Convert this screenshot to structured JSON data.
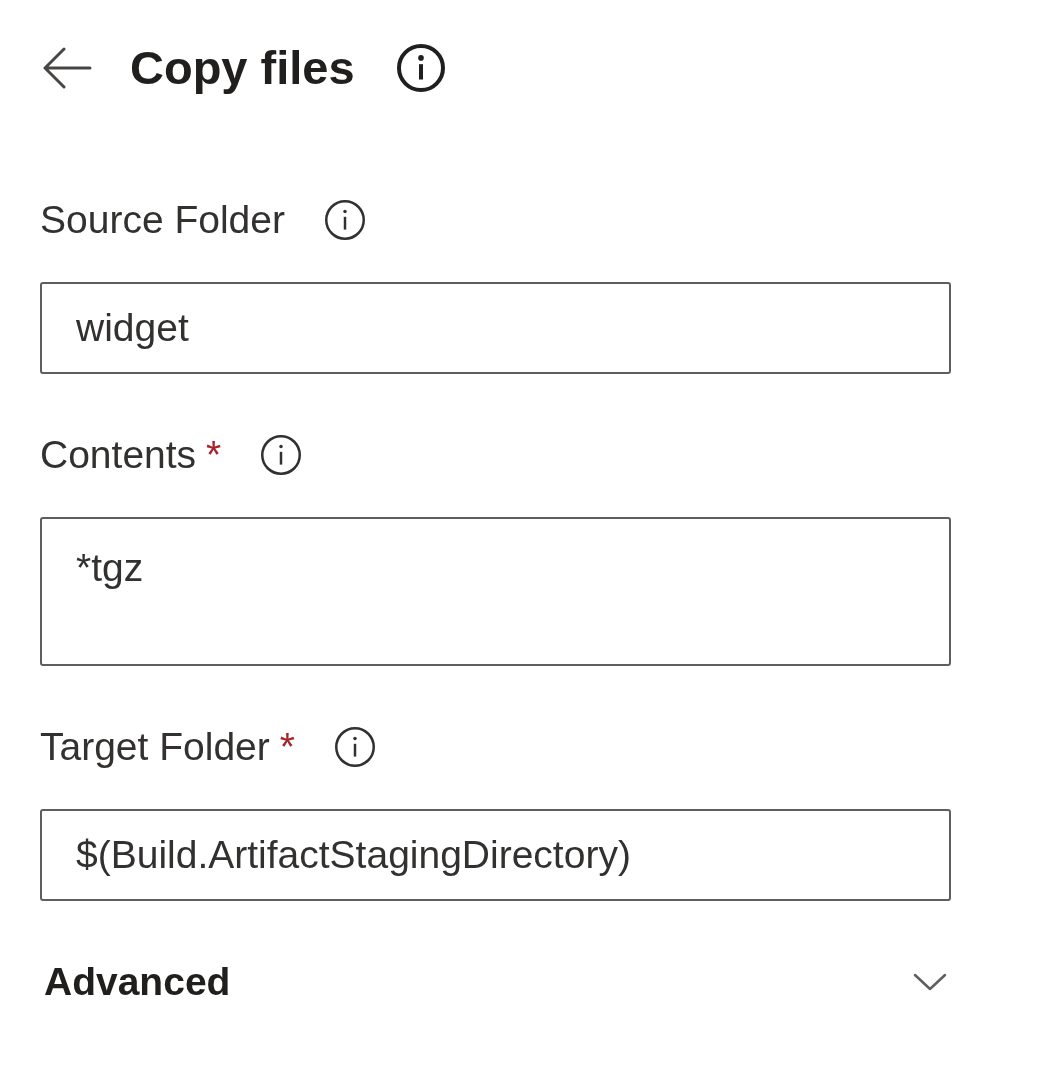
{
  "header": {
    "title": "Copy files"
  },
  "fields": [
    {
      "kind": "input",
      "label": "Source Folder",
      "value": "widget"
    },
    {
      "kind": "textarea",
      "label": "Contents",
      "required_mark": "*",
      "value": "*tgz"
    },
    {
      "kind": "input",
      "label": "Target Folder",
      "required_mark": "*",
      "value": "$(Build.ArtifactStagingDirectory)"
    }
  ],
  "advanced": {
    "label": "Advanced",
    "expanded": false
  }
}
